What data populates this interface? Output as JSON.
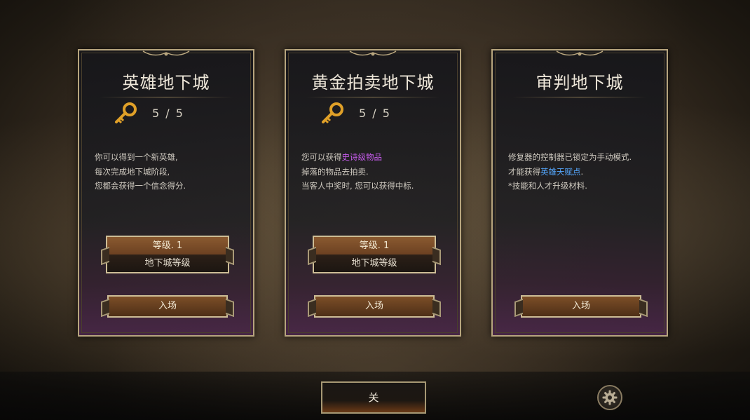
{
  "dungeons": [
    {
      "title": "英雄地下城",
      "key_count": "5 / 5",
      "desc_lines": [
        {
          "before": "你可以得到一个新英雄,",
          "highlight": "",
          "after": ""
        },
        {
          "before": "每次完成地下城阶段,",
          "highlight": "",
          "after": ""
        },
        {
          "before": "您都会获得一个信念得分.",
          "highlight": "",
          "after": ""
        }
      ],
      "level_label": "等级. 1",
      "level_name": "地下城等级",
      "enter_label": "入场"
    },
    {
      "title": "黄金拍卖地下城",
      "key_count": "5 / 5",
      "desc_lines": [
        {
          "before": "您可以获得",
          "highlight": "史诗级物品",
          "after": ""
        },
        {
          "before": "掉落的物品去拍卖.",
          "highlight": "",
          "after": ""
        },
        {
          "before": "当客人中奖时, 您可以获得中标.",
          "highlight": "",
          "after": ""
        }
      ],
      "level_label": "等级. 1",
      "level_name": "地下城等级",
      "enter_label": "入场"
    },
    {
      "title": "审判地下城",
      "key_count": "",
      "desc_lines": [
        {
          "before": "修复器的控制器已锁定为手动模式.",
          "highlight": "",
          "after": ""
        },
        {
          "before": "才能获得",
          "highlight": "英雄天赋点",
          "after": "."
        },
        {
          "before": "*技能和人才升级材料.",
          "highlight": "",
          "after": ""
        }
      ],
      "level_label": "",
      "level_name": "",
      "enter_label": "入场"
    }
  ],
  "footer": {
    "close_label": "关",
    "settings_icon": "gear-icon"
  },
  "colors": {
    "epic_highlight": "#c95df0",
    "hero_highlight": "#55a8ff",
    "frame_gold": "#b7a57e"
  }
}
